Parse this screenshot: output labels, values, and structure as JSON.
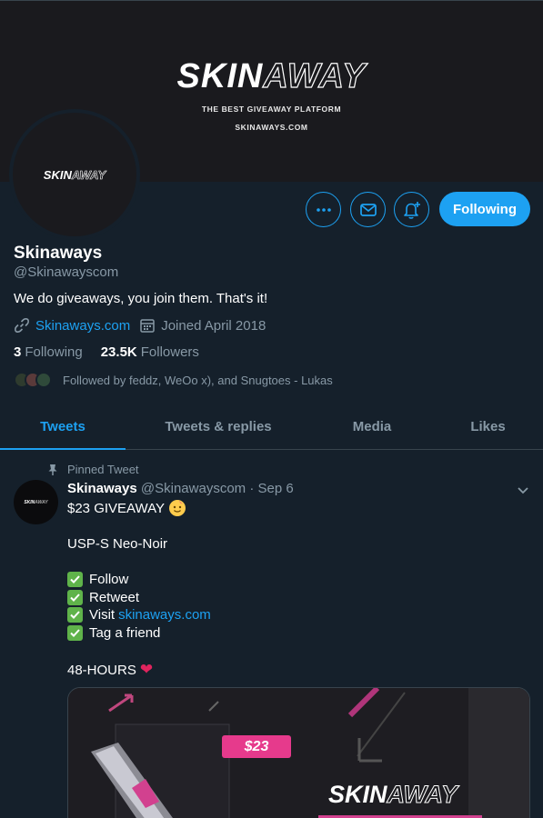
{
  "banner": {
    "logo_left": "SKIN",
    "logo_right": "AWAY",
    "tagline": "THE BEST GIVEAWAY PLATFORM",
    "url": "SKINAWAYS.COM"
  },
  "avatar": {
    "logo_left": "SKIN",
    "logo_right": "AWAY"
  },
  "actions": {
    "more_icon": "more-icon",
    "message_icon": "envelope-icon",
    "notify_icon": "bell-plus-icon",
    "follow_label": "Following"
  },
  "profile": {
    "name": "Skinaways",
    "handle": "@Skinawayscom",
    "bio": "We do giveaways, you join them. That's it!",
    "website": "Skinaways.com",
    "joined": "Joined April 2018",
    "following_count": "3",
    "following_label": "Following",
    "followers_count": "23.5K",
    "followers_label": "Followers",
    "followed_by": "Followed by feddz, WeOo x), and Snugtoes - Lukas"
  },
  "tabs": [
    {
      "label": "Tweets"
    },
    {
      "label": "Tweets & replies"
    },
    {
      "label": "Media"
    },
    {
      "label": "Likes"
    }
  ],
  "tweet": {
    "pinned_label": "Pinned Tweet",
    "name": "Skinaways",
    "handle": "@Skinawayscom",
    "separator": "·",
    "date": "Sep 6",
    "line1": "$23 GIVEAWAY",
    "line2": "USP-S Neo-Noir",
    "check1": "Follow",
    "check2": "Retweet",
    "check3_prefix": "Visit",
    "check3_link": "skinaways.com",
    "check4": "Tag a friend",
    "footer": "48-HOURS",
    "media": {
      "price": "$23",
      "logo_left": "SKIN",
      "logo_right": "AWAY"
    }
  },
  "colors": {
    "background": "#15202b",
    "accent": "#1da1f2",
    "muted": "#8899a6",
    "border": "#38444d"
  }
}
